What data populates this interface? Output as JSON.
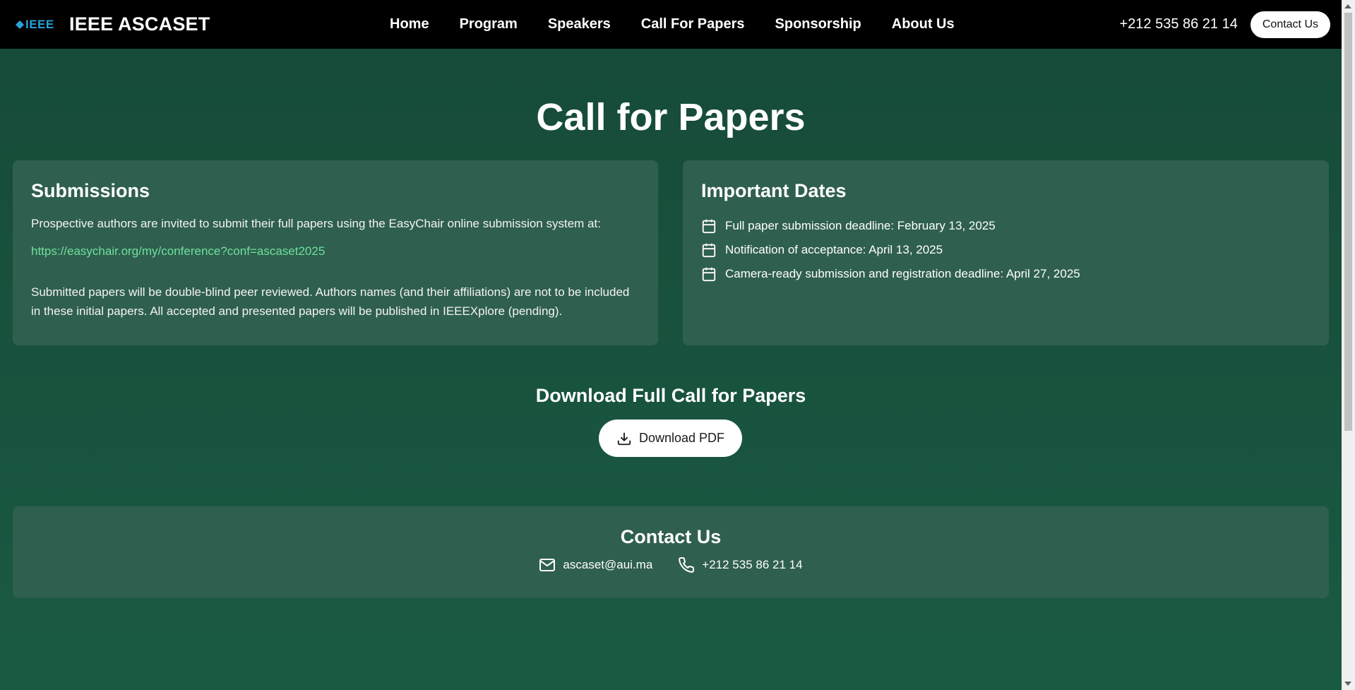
{
  "nav": {
    "logo_text": "IEEE",
    "brand": "IEEE ASCASET",
    "links": [
      "Home",
      "Program",
      "Speakers",
      "Call For Papers",
      "Sponsorship",
      "About Us"
    ],
    "phone": "+212 535 86 21 14",
    "contact_button": "Contact Us"
  },
  "page": {
    "title": "Call for Papers"
  },
  "submissions": {
    "heading": "Submissions",
    "intro": "Prospective authors are invited to submit their full papers using the EasyChair online submission system at:",
    "link": "https://easychair.org/my/conference?conf=ascaset2025",
    "body": "Submitted papers will be double-blind peer reviewed. Authors names (and their affiliations) are not to be included in these initial papers. All accepted and presented papers will be published in IEEEXplore (pending)."
  },
  "dates": {
    "heading": "Important Dates",
    "items": [
      "Full paper submission deadline: February 13, 2025",
      "Notification of acceptance: April 13, 2025",
      "Camera-ready submission and registration deadline: April 27, 2025"
    ]
  },
  "download": {
    "heading": "Download Full Call for Papers",
    "button": "Download PDF"
  },
  "contact": {
    "heading": "Contact Us",
    "email": "ascaset@aui.ma",
    "phone": "+212 535 86 21 14"
  },
  "colors": {
    "navbar": "#000000",
    "background": "#164a38",
    "card": "#2f5f4f",
    "link": "#6ee19a",
    "ieee_blue": "#2c9fd9"
  }
}
